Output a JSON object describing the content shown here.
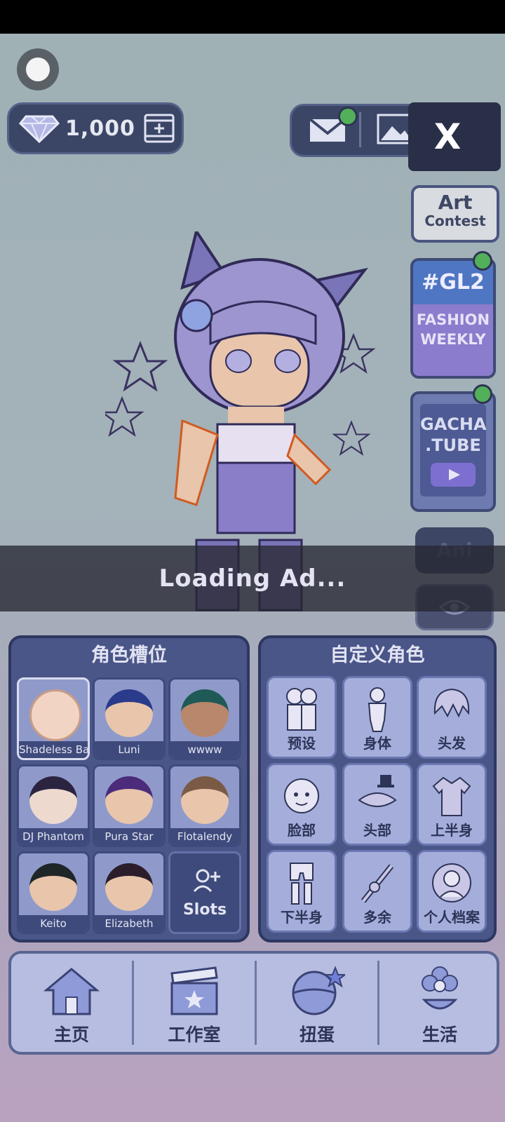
{
  "currency": {
    "gems": "1,000"
  },
  "close_label": "X",
  "side_buttons": {
    "art_contest": {
      "line1": "Art",
      "line2": "Contest"
    },
    "gl2": {
      "line1": "#GL2",
      "line2": "FASHION",
      "line3": "WEEKLY"
    },
    "gacha_tube": {
      "line1": "GACHA",
      "line2": ".TUBE"
    },
    "ani_label": "Ani"
  },
  "loading_text": "Loading Ad...",
  "character_slots": {
    "title": "角色槽位",
    "slots": [
      {
        "name": "Shadeless Bas",
        "hair": "#c89c86"
      },
      {
        "name": "Luni",
        "hair": "#2a3b8c"
      },
      {
        "name": "wwww",
        "hair": "#1f5a57"
      },
      {
        "name": "DJ Phantom",
        "hair": "#2b2440"
      },
      {
        "name": "Pura Star",
        "hair": "#4b2b7a"
      },
      {
        "name": "Flotalendy",
        "hair": "#7a5a45"
      },
      {
        "name": "Keito",
        "hair": "#1f2628"
      },
      {
        "name": "Elizabeth",
        "hair": "#2b1e2a"
      }
    ],
    "add_slots_label": "Slots"
  },
  "customize": {
    "title": "自定义角色",
    "items": [
      {
        "label": "预设",
        "icon": "preset-icon"
      },
      {
        "label": "身体",
        "icon": "body-icon"
      },
      {
        "label": "头发",
        "icon": "hair-icon"
      },
      {
        "label": "脸部",
        "icon": "face-icon"
      },
      {
        "label": "头部",
        "icon": "head-accessory-icon"
      },
      {
        "label": "上半身",
        "icon": "upper-body-icon"
      },
      {
        "label": "下半身",
        "icon": "lower-body-icon"
      },
      {
        "label": "多余",
        "icon": "extra-icon"
      },
      {
        "label": "个人档案",
        "icon": "profile-icon"
      }
    ]
  },
  "bottom_nav": [
    {
      "label": "主页",
      "icon": "home-icon"
    },
    {
      "label": "工作室",
      "icon": "studio-icon"
    },
    {
      "label": "扭蛋",
      "icon": "gacha-icon"
    },
    {
      "label": "生活",
      "icon": "life-icon"
    }
  ]
}
